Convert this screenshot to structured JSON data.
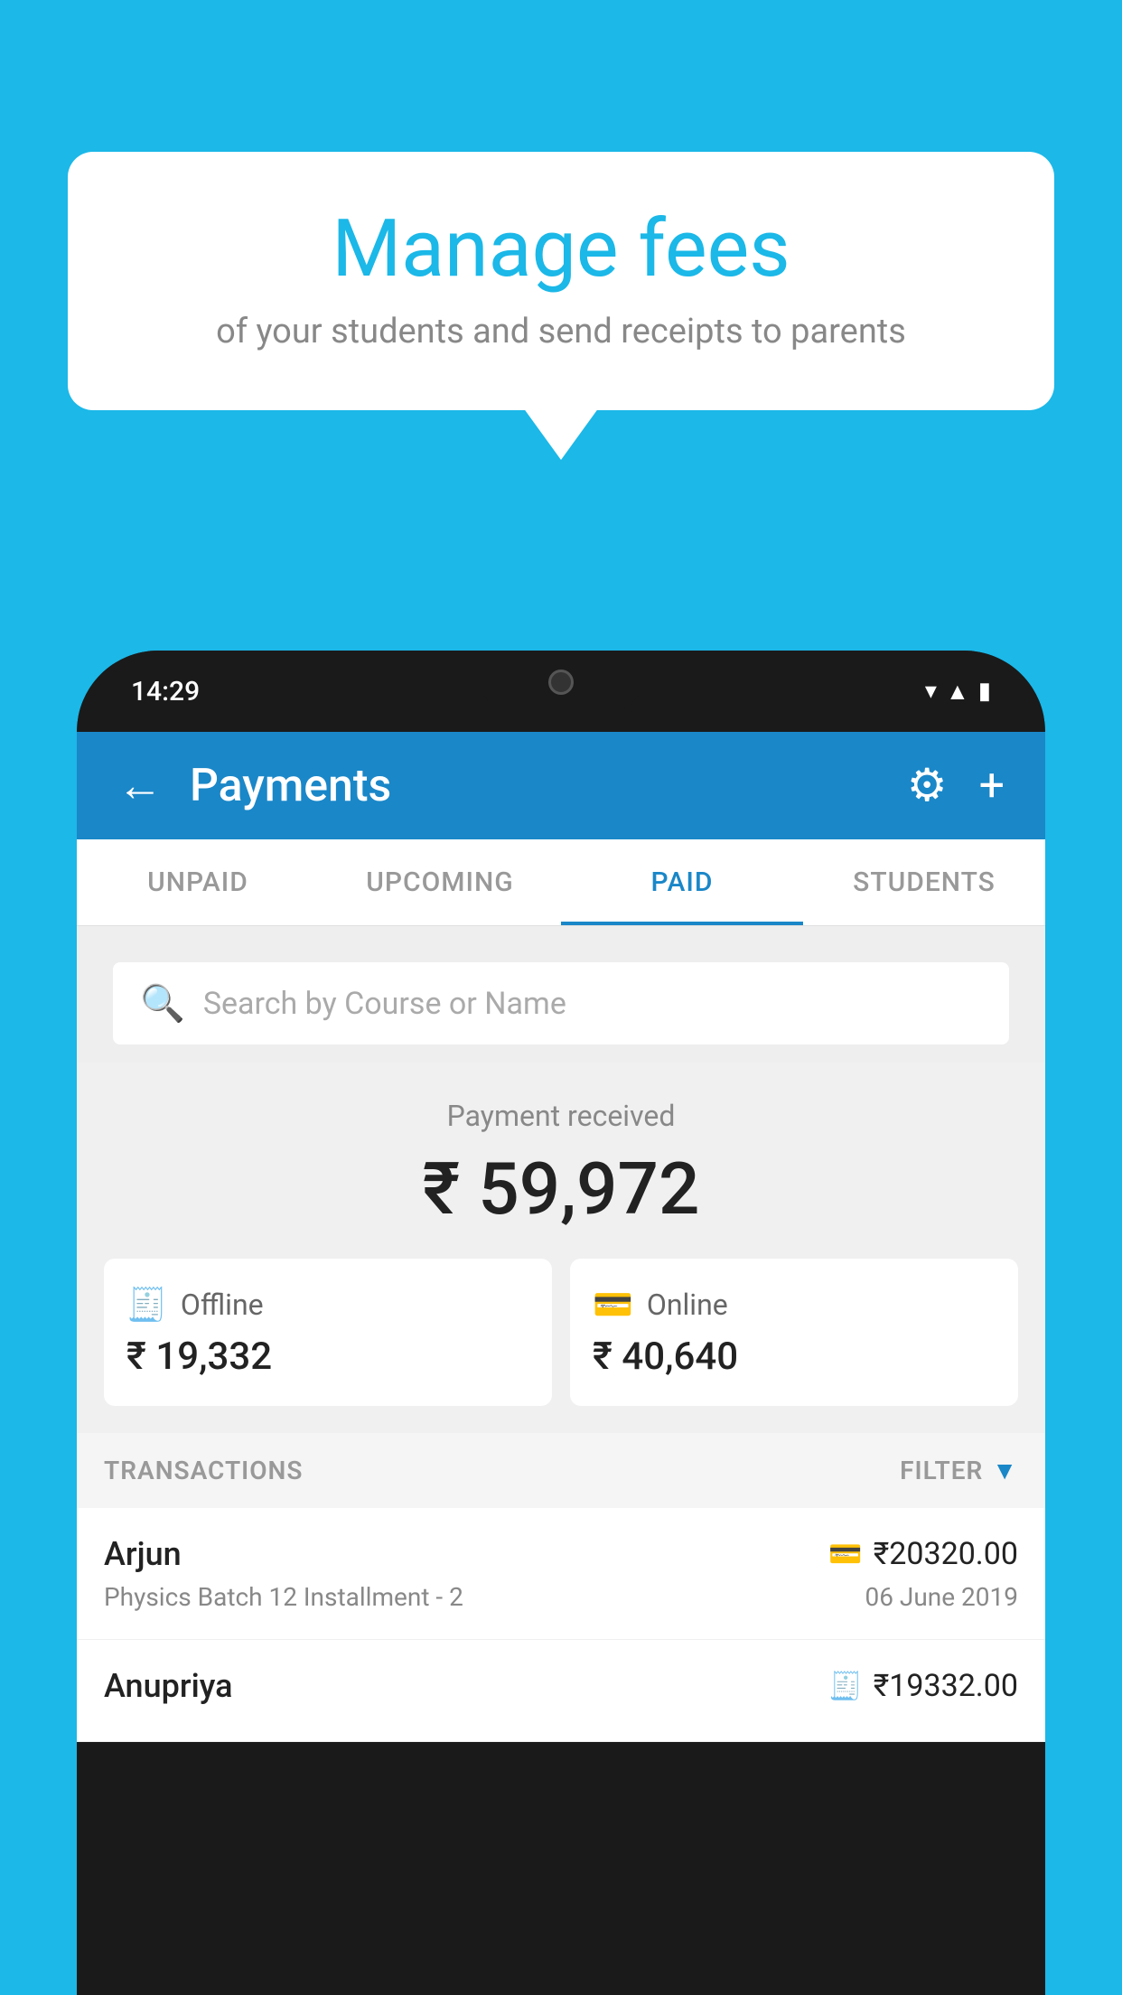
{
  "background_color": "#1bb8e8",
  "bubble": {
    "title": "Manage fees",
    "subtitle": "of your students and send receipts to parents"
  },
  "phone": {
    "status_time": "14:29",
    "header": {
      "title": "Payments",
      "back_label": "←",
      "settings_label": "⚙",
      "add_label": "+"
    },
    "tabs": [
      {
        "label": "UNPAID",
        "active": false
      },
      {
        "label": "UPCOMING",
        "active": false
      },
      {
        "label": "PAID",
        "active": true
      },
      {
        "label": "STUDENTS",
        "active": false
      }
    ],
    "search": {
      "placeholder": "Search by Course or Name"
    },
    "payment_summary": {
      "received_label": "Payment received",
      "total_amount": "₹ 59,972",
      "offline_label": "Offline",
      "offline_amount": "₹ 19,332",
      "online_label": "Online",
      "online_amount": "₹ 40,640"
    },
    "transactions": {
      "header_label": "TRANSACTIONS",
      "filter_label": "FILTER",
      "items": [
        {
          "name": "Arjun",
          "course": "Physics Batch 12 Installment - 2",
          "amount": "₹20320.00",
          "date": "06 June 2019",
          "payment_type": "card"
        },
        {
          "name": "Anupriya",
          "course": "",
          "amount": "₹19332.00",
          "date": "",
          "payment_type": "offline"
        }
      ]
    }
  }
}
